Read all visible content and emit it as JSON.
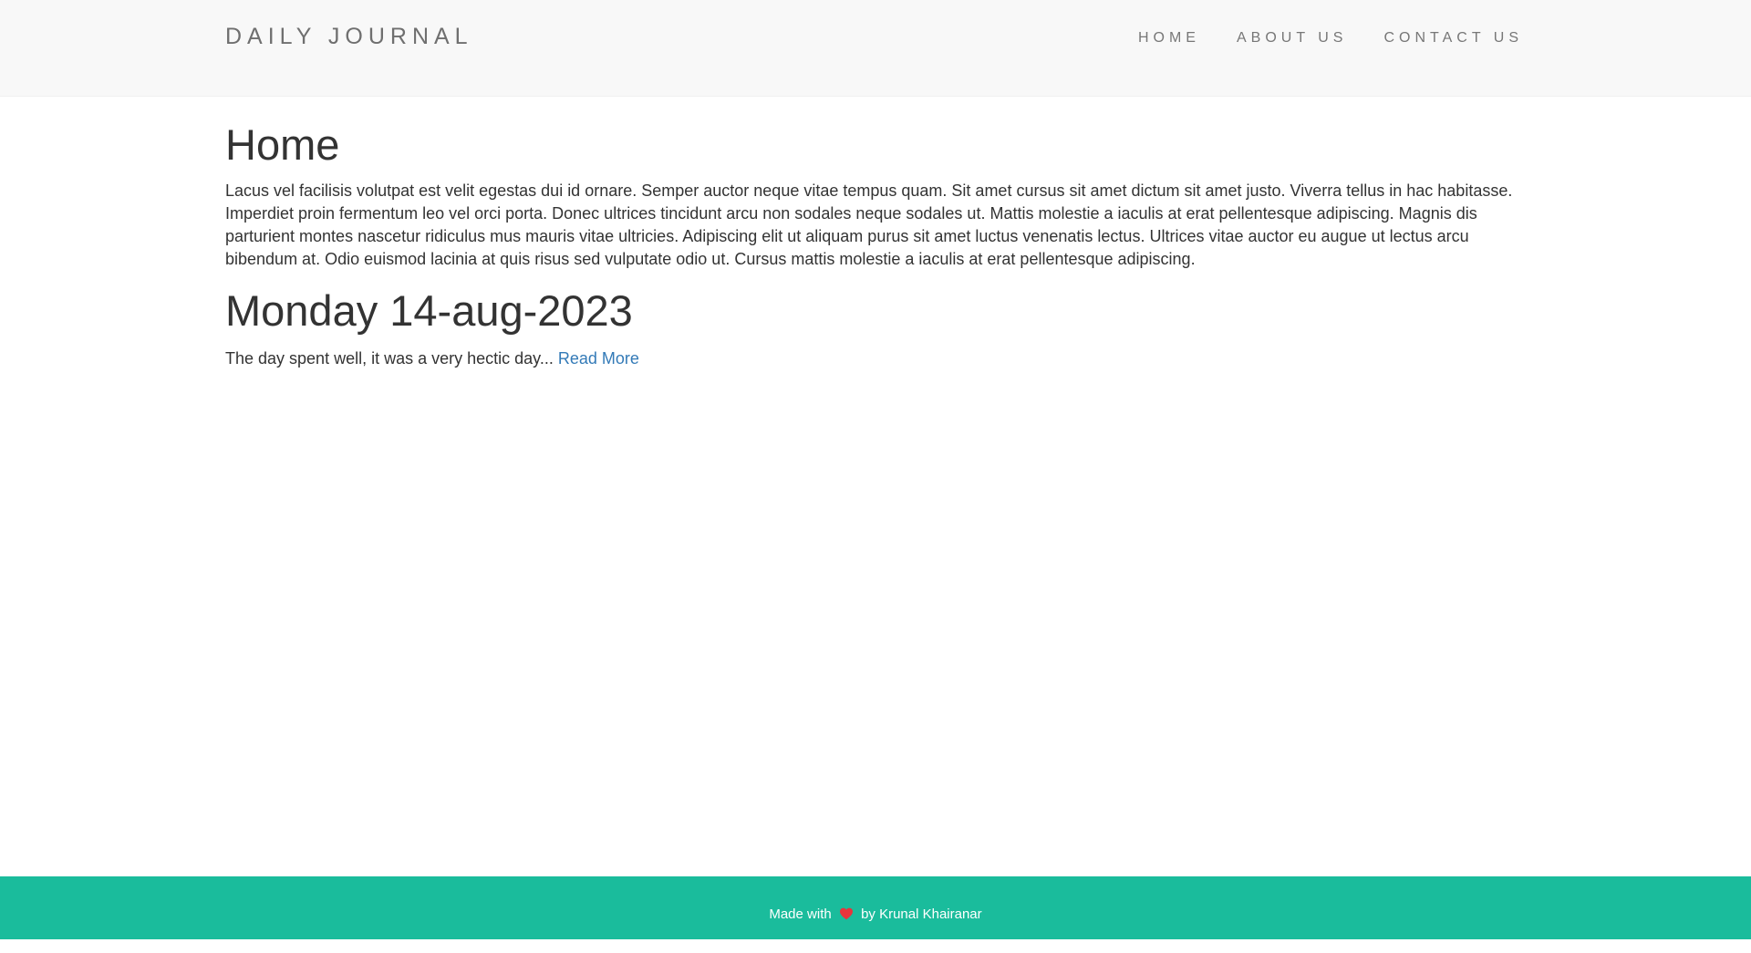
{
  "navbar": {
    "brand": "DAILY JOURNAL",
    "links": [
      "HOME",
      "ABOUT US",
      "CONTACT US"
    ]
  },
  "main": {
    "heading": "Home",
    "intro": "Lacus vel facilisis volutpat est velit egestas dui id ornare. Semper auctor neque vitae tempus quam. Sit amet cursus sit amet dictum sit amet justo. Viverra tellus in hac habitasse. Imperdiet proin fermentum leo vel orci porta. Donec ultrices tincidunt arcu non sodales neque sodales ut. Mattis molestie a iaculis at erat pellentesque adipiscing. Magnis dis parturient montes nascetur ridiculus mus mauris vitae ultricies. Adipiscing elit ut aliquam purus sit amet luctus venenatis lectus. Ultrices vitae auctor eu augue ut lectus arcu bibendum at. Odio euismod lacinia at quis risus sed vulputate odio ut. Cursus mattis molestie a iaculis at erat pellentesque adipiscing.",
    "posts": [
      {
        "title": "Monday 14-aug-2023",
        "excerpt": "The day spent well, it was a very hectic day...",
        "read_more": "Read More"
      }
    ]
  },
  "footer": {
    "prefix": "Made with",
    "icon": "heart-icon",
    "suffix": "by Krunal Khairanar",
    "background_color": "#1abc9c"
  }
}
